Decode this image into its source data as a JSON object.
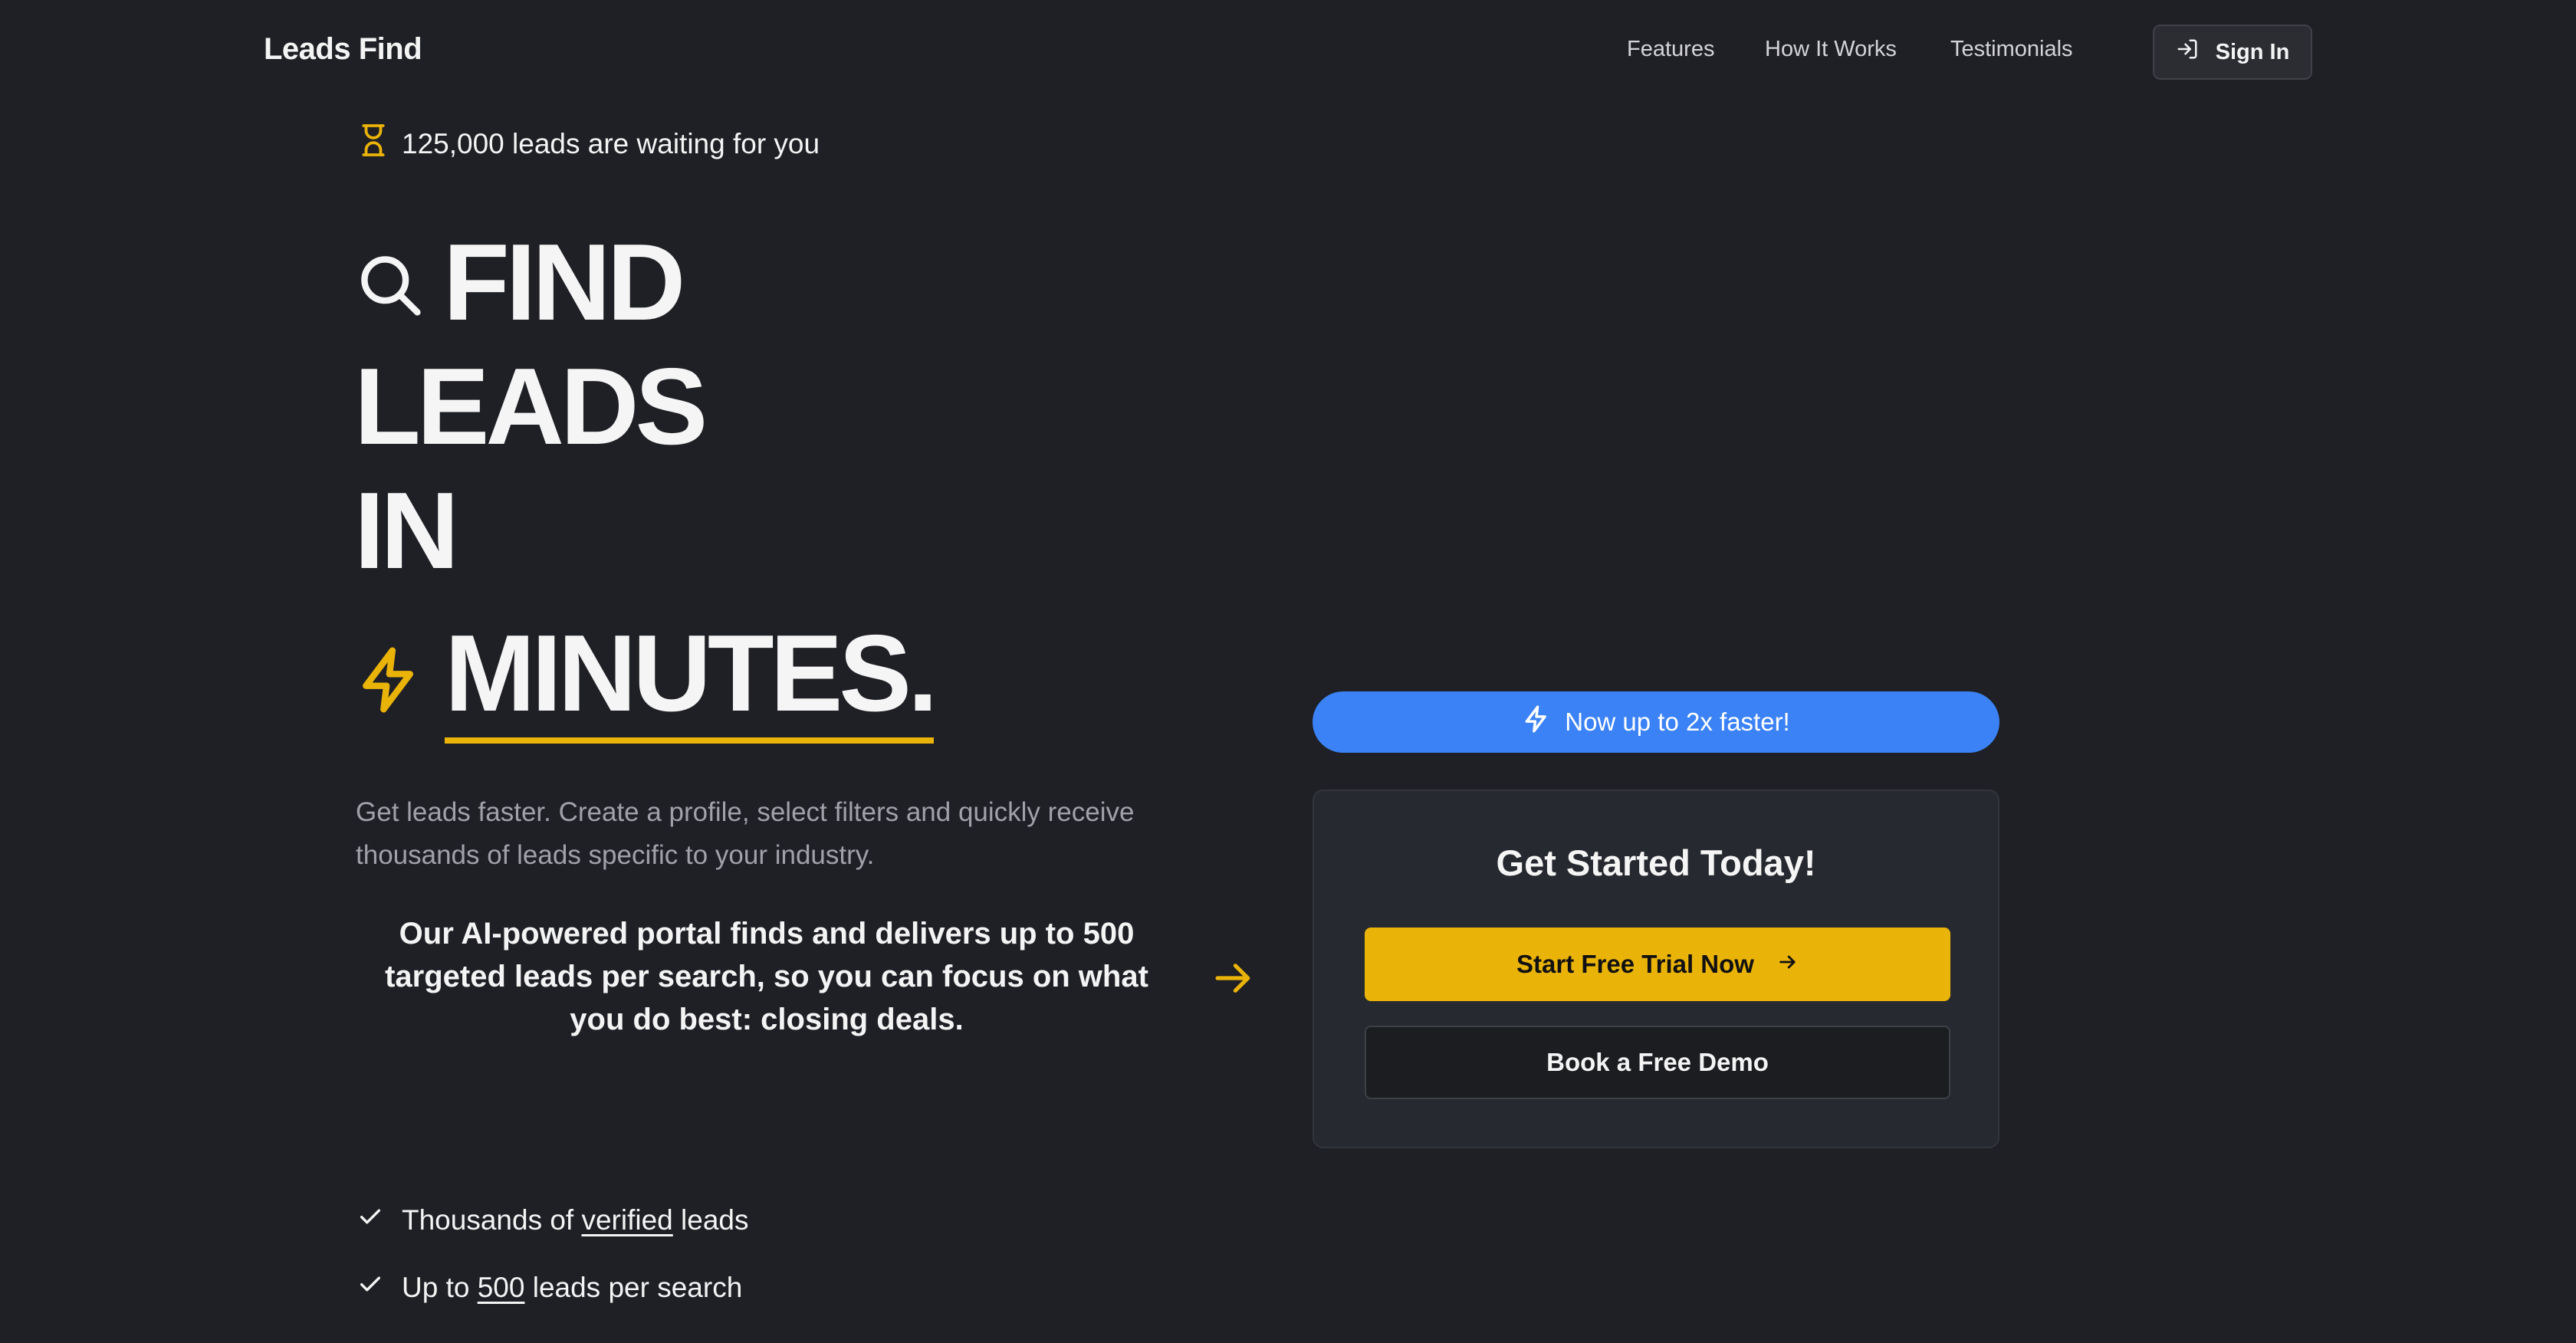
{
  "header": {
    "brand": "Leads Find",
    "nav": [
      "Features",
      "How It Works",
      "Testimonials"
    ],
    "signin_label": "Sign In"
  },
  "hero": {
    "badge_text": "125,000 leads are waiting for you",
    "headline": [
      "FIND",
      "LEADS",
      "IN",
      "MINUTES."
    ],
    "subtitle": "Get leads faster. Create a profile, select filters and quickly receive thousands of leads specific to your industry.",
    "ai_text": "Our AI-powered portal finds and delivers up to 500 targeted leads per search, so you can focus on what you do best: closing deals."
  },
  "features": [
    {
      "before": "Thousands of ",
      "highlight": "verified",
      "after": " leads"
    },
    {
      "before": "Up to ",
      "highlight": "500",
      "after": " leads per search"
    }
  ],
  "cta": {
    "pill_text": "Now up to 2x faster!",
    "title": "Get Started Today!",
    "primary_label": "Start Free Trial Now",
    "secondary_label": "Book a Free Demo"
  },
  "colors": {
    "background": "#1f2025",
    "accent_yellow": "#eab308",
    "accent_blue": "#3b82f6",
    "card": "#272930"
  },
  "icons": [
    "hourglass-icon",
    "search-icon",
    "lightning-icon",
    "arrow-right-icon",
    "check-icon",
    "sign-in-icon"
  ]
}
